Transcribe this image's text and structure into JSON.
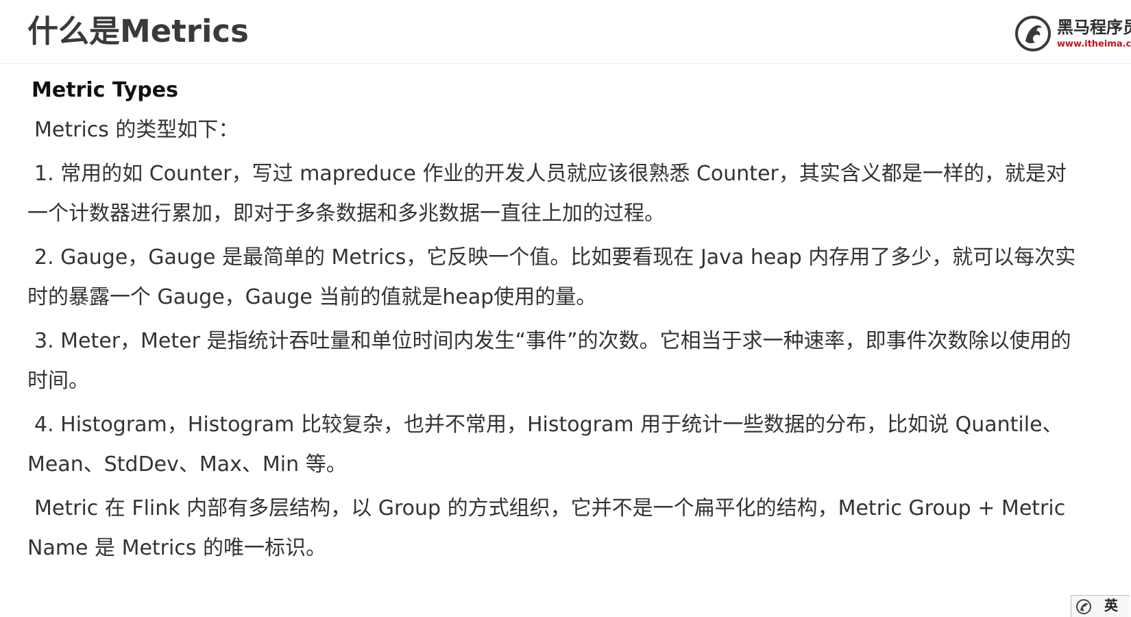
{
  "header": {
    "title": "什么是Metrics",
    "logo": {
      "name": "黑马程序员",
      "url": "www.itheima.com",
      "icon": "horse-emblem-icon",
      "url_color": "#c4161c"
    }
  },
  "content": {
    "heading": "Metric Types",
    "intro": "Metrics 的类型如下：",
    "paragraphs": [
      "1. 常用的如 Counter，写过 mapreduce 作业的开发人员就应该很熟悉 Counter，其实含义都是一样的，就是对一个计数器进行累加，即对于多条数据和多兆数据一直往上加的过程。",
      "2. Gauge，Gauge 是最简单的 Metrics，它反映一个值。比如要看现在 Java heap 内存用了多少，就可以每次实时的暴露一个 Gauge，Gauge 当前的值就是heap使用的量。",
      "3. Meter，Meter 是指统计吞吐量和单位时间内发生“事件”的次数。它相当于求一种速率，即事件次数除以使用的时间。",
      "4. Histogram，Histogram 比较复杂，也并不常用，Histogram 用于统计一些数据的分布，比如说 Quantile、Mean、StdDev、Max、Min 等。",
      "Metric 在 Flink 内部有多层结构，以 Group 的方式组织，它并不是一个扁平化的结构，Metric Group + Metric Name 是 Metrics 的唯一标识。"
    ]
  },
  "ime": {
    "label": "英",
    "icon": "ime-logo-icon"
  }
}
